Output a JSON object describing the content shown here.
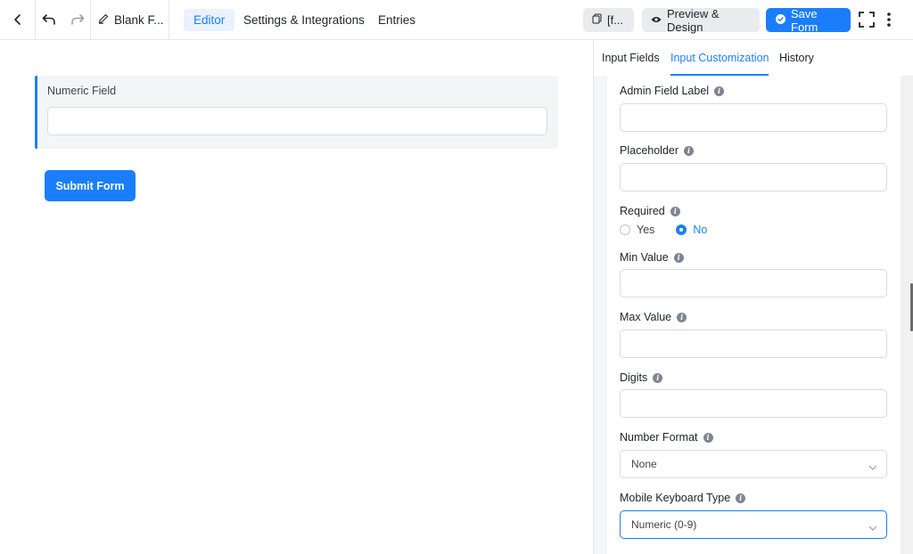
{
  "toolbar": {
    "form_title": "Blank F...",
    "tabs": [
      {
        "label": "Editor",
        "active": true
      },
      {
        "label": "Settings & Integrations",
        "active": false
      },
      {
        "label": "Entries",
        "active": false
      }
    ],
    "shortcode_label": "[f...",
    "preview_label": "Preview & Design",
    "save_label": "Save Form",
    "icons": [
      "back-chevron-icon",
      "undo-icon",
      "redo-icon",
      "pencil-icon",
      "copy-icon",
      "eye-icon",
      "check-circle-icon",
      "fullscreen-icon",
      "more-vertical-icon"
    ]
  },
  "canvas": {
    "field_label": "Numeric Field",
    "field_value": "",
    "submit_label": "Submit Form"
  },
  "panel": {
    "tabs": [
      {
        "label": "Input Fields",
        "active": false
      },
      {
        "label": "Input Customization",
        "active": true
      },
      {
        "label": "History",
        "active": false
      }
    ],
    "settings": {
      "admin_label": {
        "label": "Admin Field Label",
        "value": ""
      },
      "placeholder": {
        "label": "Placeholder",
        "value": ""
      },
      "required": {
        "label": "Required",
        "options": [
          "Yes",
          "No"
        ],
        "selected": "No"
      },
      "min_value": {
        "label": "Min Value",
        "value": ""
      },
      "max_value": {
        "label": "Max Value",
        "value": ""
      },
      "digits": {
        "label": "Digits",
        "value": ""
      },
      "number_format": {
        "label": "Number Format",
        "value": "None"
      },
      "keyboard_type": {
        "label": "Mobile Keyboard Type",
        "value": "Numeric (0-9)"
      }
    }
  },
  "colors": {
    "accent": "#1a7efb",
    "panel_bg": "#f4f5f6",
    "border": "#dadbdd"
  }
}
